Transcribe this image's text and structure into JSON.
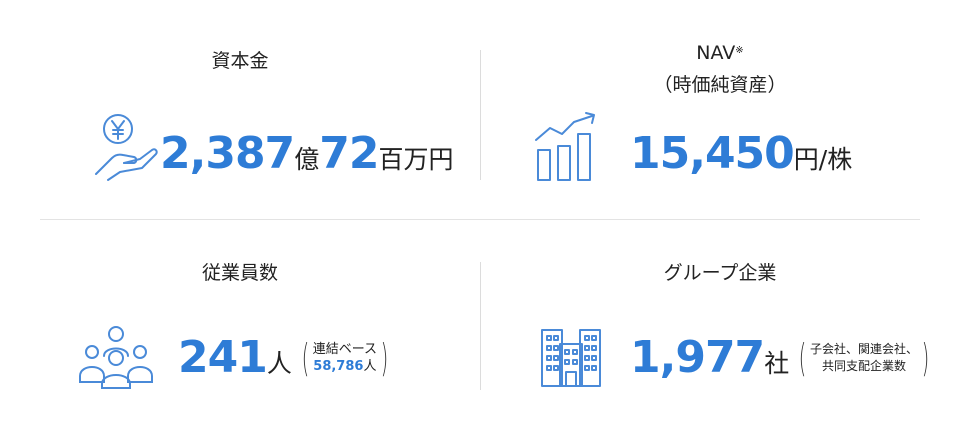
{
  "capital": {
    "title": "資本金",
    "value_major": "2,387",
    "unit_major": "億",
    "value_minor": "72",
    "unit_minor": "百万円",
    "icon": "yen-coin-hand-icon"
  },
  "nav": {
    "title": "NAV",
    "title_mark": "※",
    "subtitle": "（時価純資産）",
    "value": "15,450",
    "unit": "円/株",
    "icon": "growth-bar-chart-icon"
  },
  "employees": {
    "title": "従業員数",
    "value": "241",
    "unit": "人",
    "note_line1": "連結ベース",
    "note_value": "58,786",
    "note_unit": "人",
    "icon": "people-group-icon"
  },
  "group": {
    "title": "グループ企業",
    "value": "1,977",
    "unit": "社",
    "note_line1": "子会社、関連会社、",
    "note_line2": "共同支配企業数",
    "icon": "office-building-icon"
  },
  "colors": {
    "accent": "#2e7cd6",
    "icon_stroke": "#4a8ad8",
    "divider": "#dcdcdc"
  }
}
